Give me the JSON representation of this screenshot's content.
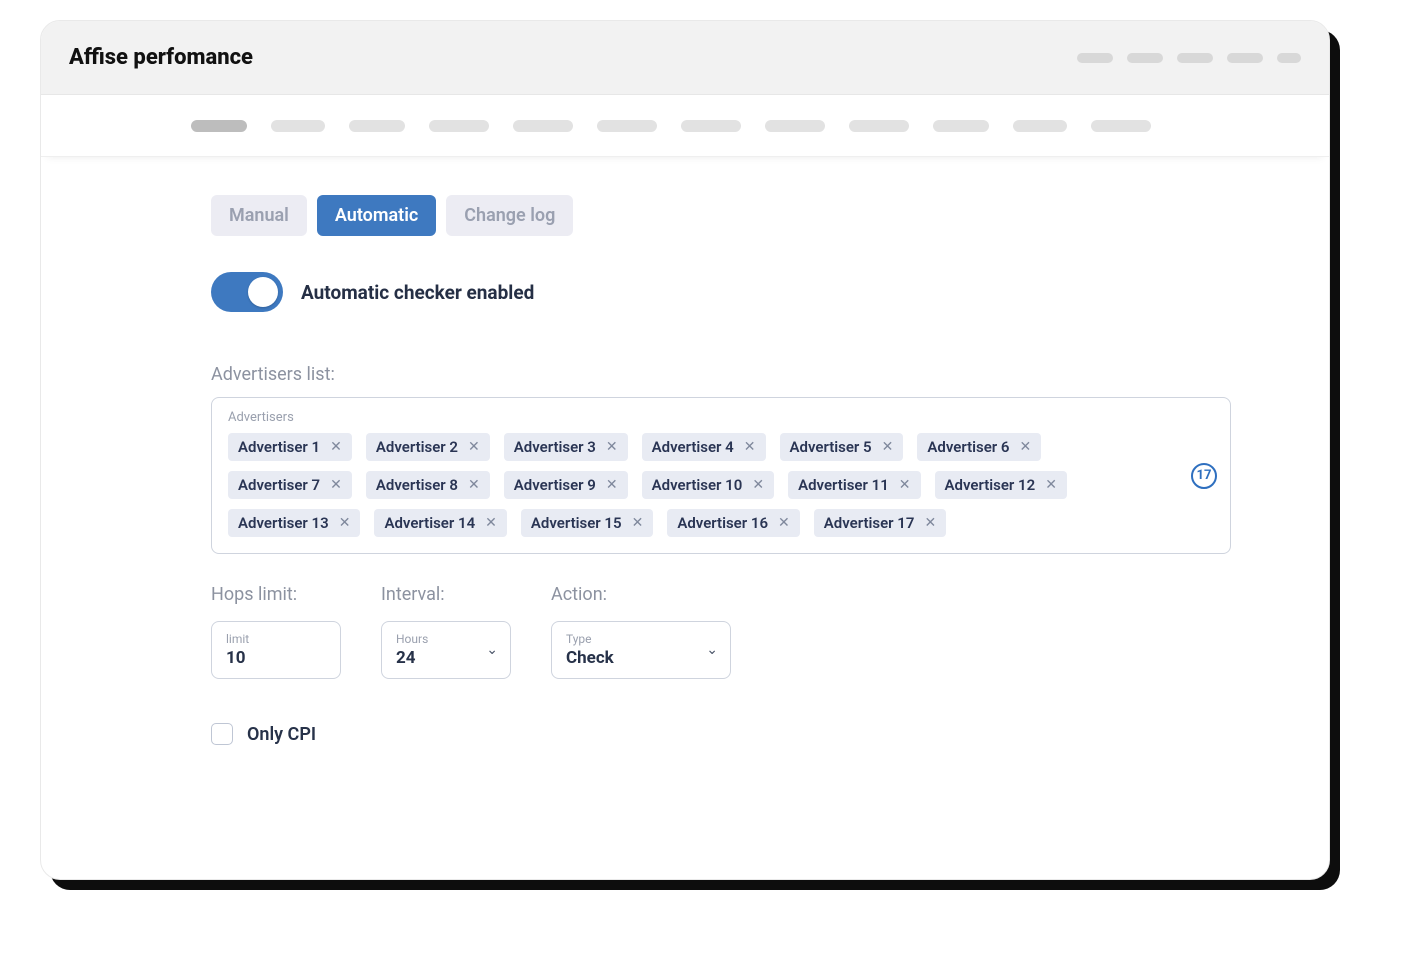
{
  "header": {
    "title": "Affise perfomance"
  },
  "tabs": {
    "manual": "Manual",
    "automatic": "Automatic",
    "changelog": "Change log"
  },
  "toggle": {
    "label": "Automatic checker enabled",
    "on": true
  },
  "advertisers": {
    "section_label": "Advertisers list:",
    "field_label": "Advertisers",
    "count": "17",
    "items": [
      "Advertiser 1",
      "Advertiser 2",
      "Advertiser 3",
      "Advertiser 4",
      "Advertiser 5",
      "Advertiser 6",
      "Advertiser 7",
      "Advertiser 8",
      "Advertiser 9",
      "Advertiser 10",
      "Advertiser 11",
      "Advertiser 12",
      "Advertiser 13",
      "Advertiser 14",
      "Advertiser 15",
      "Advertiser 16",
      "Advertiser 17"
    ]
  },
  "hops": {
    "title": "Hops limit:",
    "label": "limit",
    "value": "10"
  },
  "interval": {
    "title": "Interval:",
    "label": "Hours",
    "value": "24"
  },
  "action": {
    "title": "Action:",
    "label": "Type",
    "value": "Check"
  },
  "only_cpi": {
    "label": "Only CPI",
    "checked": false
  },
  "nav_pill_widths": [
    56,
    54,
    56,
    60,
    60,
    60,
    60,
    60,
    60,
    56,
    54,
    60
  ],
  "colors": {
    "accent": "#3e79c0",
    "chip_bg": "#e8ebf3",
    "text_dark": "#273249"
  }
}
